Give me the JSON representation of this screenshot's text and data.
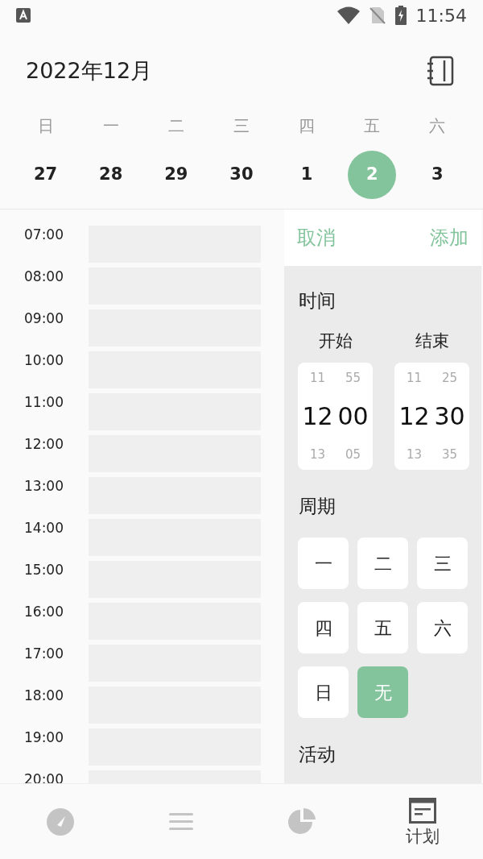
{
  "status_bar": {
    "time": "11:54"
  },
  "header": {
    "title": "2022年12月"
  },
  "week": {
    "weekdays": [
      "日",
      "一",
      "二",
      "三",
      "四",
      "五",
      "六"
    ],
    "dates": [
      {
        "label": "27",
        "selected": false
      },
      {
        "label": "28",
        "selected": false
      },
      {
        "label": "29",
        "selected": false
      },
      {
        "label": "30",
        "selected": false
      },
      {
        "label": "1",
        "selected": false
      },
      {
        "label": "2",
        "selected": true
      },
      {
        "label": "3",
        "selected": false
      }
    ]
  },
  "timeline": [
    "07:00",
    "08:00",
    "09:00",
    "10:00",
    "11:00",
    "12:00",
    "13:00",
    "14:00",
    "15:00",
    "16:00",
    "17:00",
    "18:00",
    "19:00",
    "20:00"
  ],
  "panel": {
    "cancel": "取消",
    "add": "添加",
    "time_heading": "时间",
    "pickers": [
      {
        "label": "开始",
        "hours": [
          "11",
          "12",
          "13"
        ],
        "minutes": [
          "55",
          "00",
          "05"
        ]
      },
      {
        "label": "结束",
        "hours": [
          "11",
          "12",
          "13"
        ],
        "minutes": [
          "25",
          "30",
          "35"
        ]
      }
    ],
    "repeat_heading": "周期",
    "repeat_options": [
      {
        "label": "一",
        "selected": false
      },
      {
        "label": "二",
        "selected": false
      },
      {
        "label": "三",
        "selected": false
      },
      {
        "label": "四",
        "selected": false
      },
      {
        "label": "五",
        "selected": false
      },
      {
        "label": "六",
        "selected": false
      },
      {
        "label": "日",
        "selected": false
      },
      {
        "label": "无",
        "selected": true
      }
    ],
    "activity_heading": "活动"
  },
  "nav": [
    {
      "kind": "gauge",
      "selected": false
    },
    {
      "kind": "list",
      "selected": false
    },
    {
      "kind": "pie",
      "selected": false
    },
    {
      "kind": "plan",
      "selected": true,
      "label": "计划"
    }
  ]
}
